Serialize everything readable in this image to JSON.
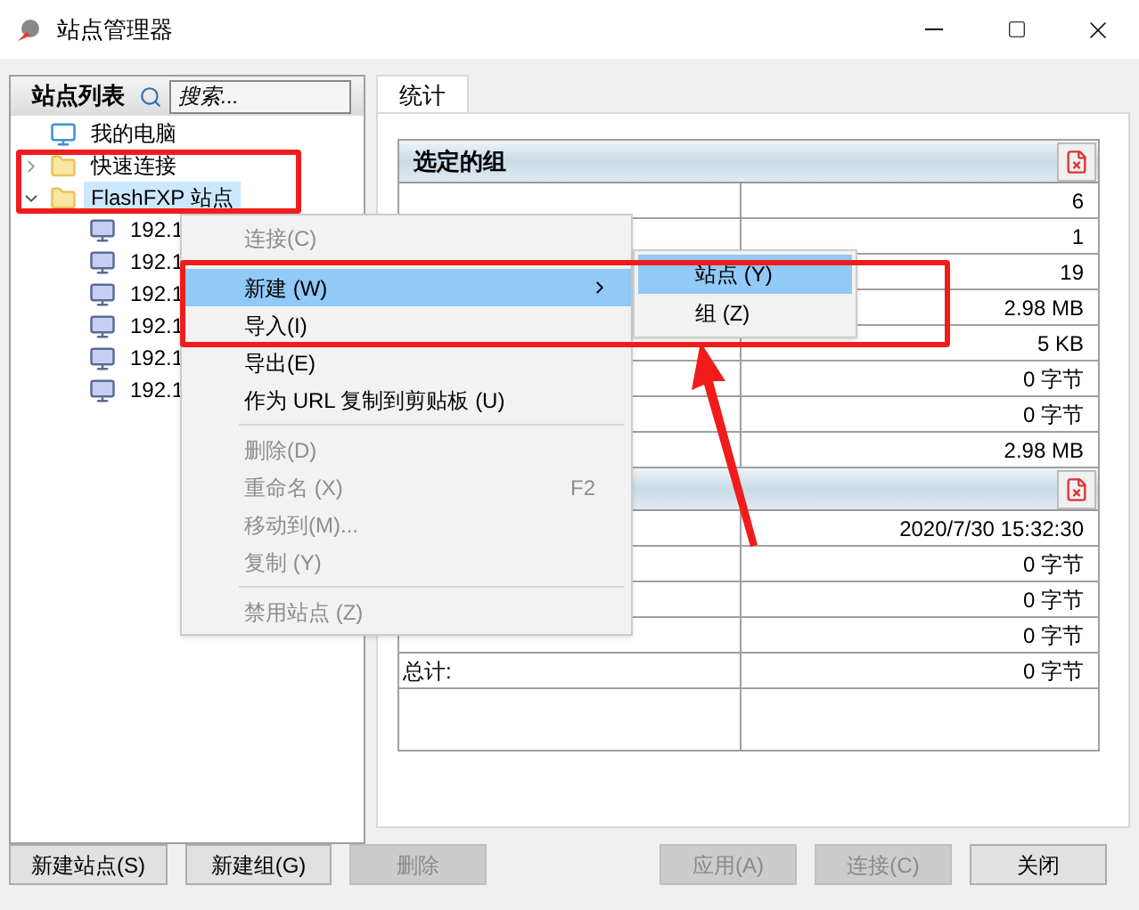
{
  "window": {
    "title": "站点管理器"
  },
  "site_list": {
    "title": "站点列表",
    "search": {
      "placeholder": "搜索..."
    },
    "tree": [
      {
        "label": "我的电脑",
        "kind": "computer",
        "selected": false
      },
      {
        "label": "快速连接",
        "kind": "folder",
        "selected": false,
        "expanded": false
      },
      {
        "label": "FlashFXP 站点",
        "kind": "folder",
        "selected": true,
        "expanded": true,
        "children": [
          {
            "label": "192.1",
            "kind": "site",
            "selected": false
          },
          {
            "label": "192.1",
            "kind": "site",
            "selected": false
          },
          {
            "label": "192.1",
            "kind": "site",
            "selected": false
          },
          {
            "label": "192.1",
            "kind": "site",
            "selected": false
          },
          {
            "label": "192.1",
            "kind": "site",
            "selected": false
          },
          {
            "label": "192.1",
            "kind": "site",
            "selected": false
          }
        ]
      }
    ]
  },
  "tabs": [
    {
      "label": "统计",
      "selected": true
    }
  ],
  "stats": [
    {
      "title": "选定的组",
      "rows": [
        {
          "value": "6"
        },
        {
          "value": "1"
        },
        {
          "value": "19"
        },
        {
          "value": "2.98 MB"
        },
        {
          "value": "5 KB"
        },
        {
          "value": "0 字节"
        },
        {
          "value": "0 字节"
        },
        {
          "value": "2.98 MB"
        }
      ]
    },
    {
      "rows": [
        {
          "value": "2020/7/30 15:32:30"
        },
        {
          "value": "0 字节"
        },
        {
          "value": "0 字节"
        },
        {
          "value": "0 字节"
        },
        {
          "label": "总计:",
          "value": "0 字节"
        }
      ]
    }
  ],
  "context_menu": [
    {
      "kind": "item",
      "label": "连接(C)",
      "disabled": true,
      "selected": false
    },
    {
      "kind": "separator"
    },
    {
      "kind": "submenu",
      "label": "新建 (W)",
      "disabled": false,
      "selected": true
    },
    {
      "kind": "item",
      "label": "导入(I)",
      "disabled": false,
      "selected": false
    },
    {
      "kind": "item",
      "label": "导出(E)",
      "disabled": false,
      "selected": false
    },
    {
      "kind": "item",
      "label": "作为 URL 复制到剪贴板 (U)",
      "disabled": false,
      "selected": false
    },
    {
      "kind": "separator"
    },
    {
      "kind": "item",
      "label": "删除(D)",
      "disabled": true,
      "selected": false
    },
    {
      "kind": "item",
      "label": "重命名 (X)",
      "shortcut": "F2",
      "disabled": true,
      "selected": false
    },
    {
      "kind": "item",
      "label": "移动到(M)...",
      "disabled": true,
      "selected": false
    },
    {
      "kind": "item",
      "label": "复制 (Y)",
      "disabled": true,
      "selected": false
    },
    {
      "kind": "separator"
    },
    {
      "kind": "item",
      "label": "禁用站点 (Z)",
      "disabled": true,
      "selected": false
    }
  ],
  "submenu": [
    {
      "label": "站点 (Y)",
      "selected": true
    },
    {
      "label": "组 (Z)",
      "selected": false
    }
  ],
  "buttons_left": [
    {
      "label": "新建站点(S)",
      "disabled": false
    },
    {
      "label": "新建组(G)",
      "disabled": false
    },
    {
      "label": "删除",
      "disabled": true
    }
  ],
  "buttons_right": [
    {
      "label": "应用(A)",
      "disabled": true
    },
    {
      "label": "连接(C)",
      "disabled": true
    },
    {
      "label": "关闭",
      "disabled": false
    }
  ],
  "annotations": [
    {
      "kind": "box"
    },
    {
      "kind": "box"
    },
    {
      "kind": "arrow"
    }
  ]
}
